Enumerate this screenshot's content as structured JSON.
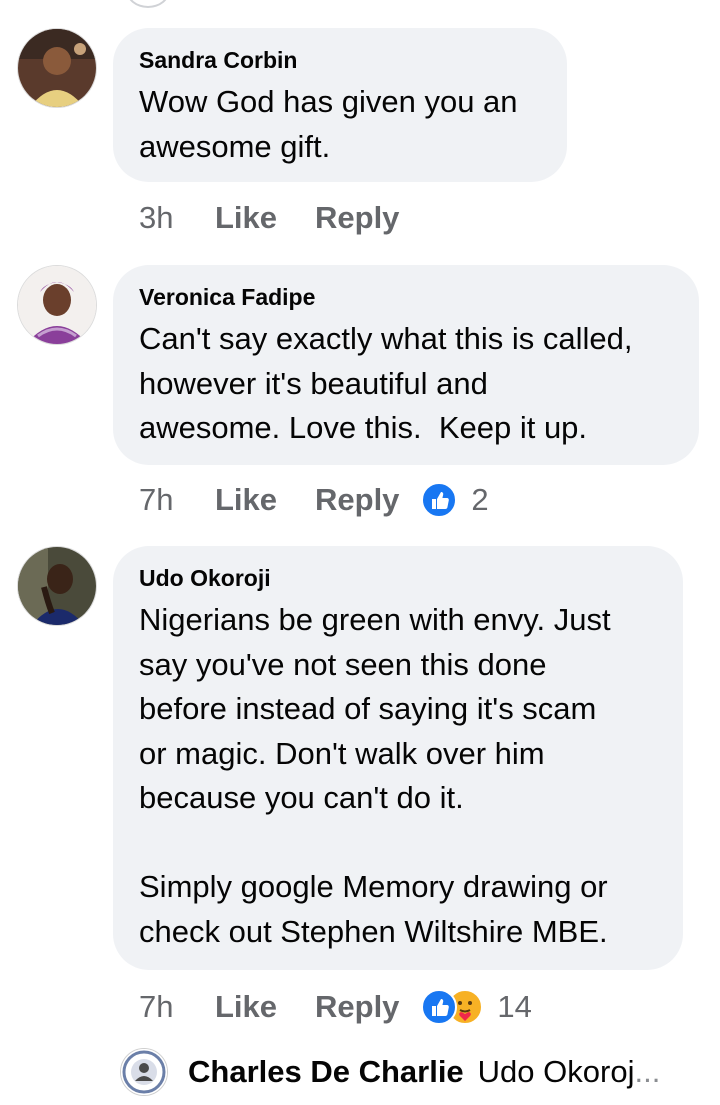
{
  "comments": [
    {
      "author": "Sandra Corbin",
      "text": "Wow God has given you an\nawesome gift.",
      "time": "3h",
      "like": "Like",
      "reply": "Reply"
    },
    {
      "author": "Veronica Fadipe",
      "text": "Can't say exactly what this is called,\nhowever it's beautiful and\nawesome. Love this.  Keep it up.",
      "time": "7h",
      "like": "Like",
      "reply": "Reply",
      "reaction_count": "2"
    },
    {
      "author": "Udo Okoroji",
      "text": "Nigerians be green with envy. Just\nsay you've not seen this done\nbefore instead of saying it's scam\nor magic. Don't walk over him\nbecause you can't do it.\n\nSimply google Memory drawing or\ncheck out Stephen Wiltshire MBE.",
      "time": "7h",
      "like": "Like",
      "reply": "Reply",
      "reaction_count": "14"
    }
  ],
  "reply_preview": {
    "author": "Charles De Charlie",
    "text": "Udo Okoroj",
    "ellipsis": "..."
  },
  "colors": {
    "bubble": "#f0f2f5",
    "meta_text": "#65676b",
    "like_reaction": "#1877f2",
    "care_reaction": "#f7b125"
  }
}
